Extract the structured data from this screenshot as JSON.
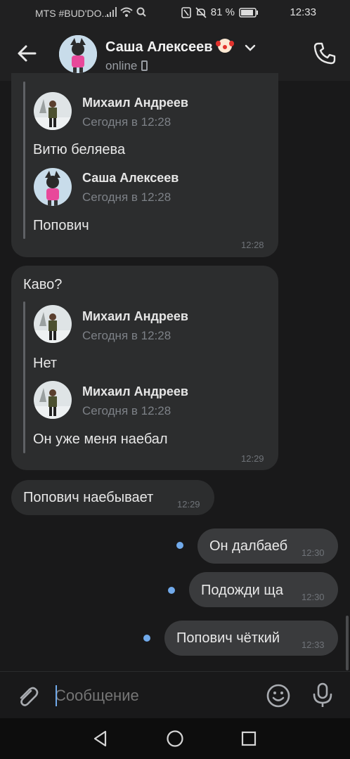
{
  "status_bar": {
    "carrier": "MTS #BUD'DO...",
    "battery": "81 %",
    "time": "12:33",
    "icons": [
      "signal-icon",
      "wifi-icon",
      "search-icon",
      "nfc-icon",
      "mute-icon",
      "battery-icon"
    ]
  },
  "header": {
    "name": "Саша Алексеев",
    "status": "online",
    "icons": [
      "back-arrow-icon",
      "clown-emoji-icon",
      "chevron-down-icon",
      "mobile-phone-icon",
      "phone-call-icon"
    ]
  },
  "messages": [
    {
      "id": "m1",
      "direction": "in",
      "quotes": [
        {
          "author": "Михаил Андреев",
          "date": "Сегодня в 12:28",
          "text": "Витю беляева"
        },
        {
          "author": "Саша Алексеев",
          "date": "Сегодня в 12:28",
          "text": "Попович"
        }
      ],
      "time": "12:28"
    },
    {
      "id": "m2",
      "direction": "in",
      "text": "Каво?",
      "quotes": [
        {
          "author": "Михаил Андреев",
          "date": "Сегодня в 12:28",
          "text": "Нет"
        },
        {
          "author": "Михаил Андреев",
          "date": "Сегодня в 12:28",
          "text": "Он уже меня наебал"
        }
      ],
      "time": "12:29"
    },
    {
      "id": "m3",
      "direction": "in",
      "text": "Попович наебывает",
      "time": "12:29"
    },
    {
      "id": "m4",
      "direction": "out",
      "text": "Он далбаеб",
      "time": "12:30",
      "unread": true
    },
    {
      "id": "m5",
      "direction": "out",
      "text": "Подожди ща",
      "time": "12:30",
      "unread": true
    },
    {
      "id": "m6",
      "direction": "out",
      "text": "Попович чёткий",
      "time": "12:33",
      "unread": true
    }
  ],
  "composer": {
    "placeholder": "Сообщение",
    "icons": [
      "paperclip-icon",
      "emoji-icon",
      "microphone-icon"
    ]
  },
  "nav_bar": {
    "icons": [
      "back-triangle-icon",
      "home-circle-icon",
      "recents-square-icon"
    ]
  },
  "colors": {
    "background": "#19191a",
    "bubble_in": "#2c2d2e",
    "bubble_out": "#3a3b3d",
    "accent": "#71aaeb",
    "text_primary": "#e1e3e6",
    "text_secondary": "#7d8187"
  }
}
